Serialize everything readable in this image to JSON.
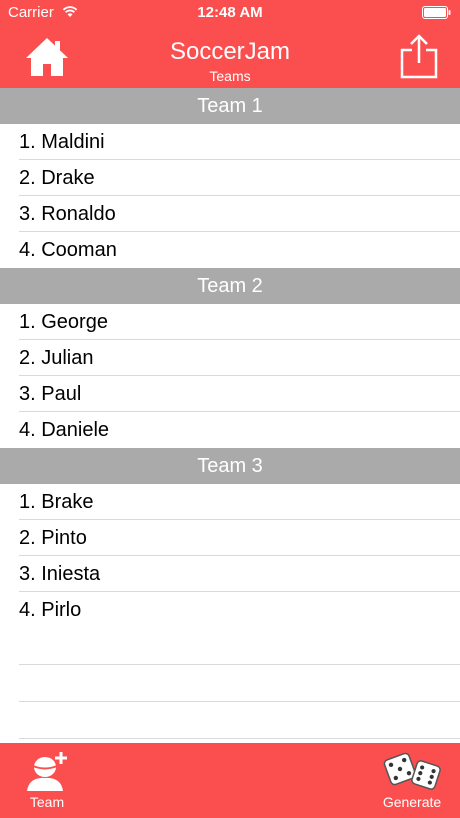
{
  "status": {
    "carrier": "Carrier",
    "time": "12:48 AM"
  },
  "nav": {
    "title": "SoccerJam",
    "subtitle": "Teams"
  },
  "sections": [
    {
      "header": "Team 1",
      "players": [
        "1. Maldini",
        "2. Drake",
        "3. Ronaldo",
        "4. Cooman"
      ]
    },
    {
      "header": "Team 2",
      "players": [
        "1. George",
        "2. Julian",
        "3. Paul",
        "4. Daniele"
      ]
    },
    {
      "header": "Team 3",
      "players": [
        "1. Brake",
        "2. Pinto",
        "3. Iniesta",
        "4. Pirlo"
      ]
    }
  ],
  "tabs": {
    "team": "Team",
    "generate": "Generate"
  },
  "colors": {
    "accent": "#fb4f4f",
    "section_header": "#aaaaaa"
  }
}
